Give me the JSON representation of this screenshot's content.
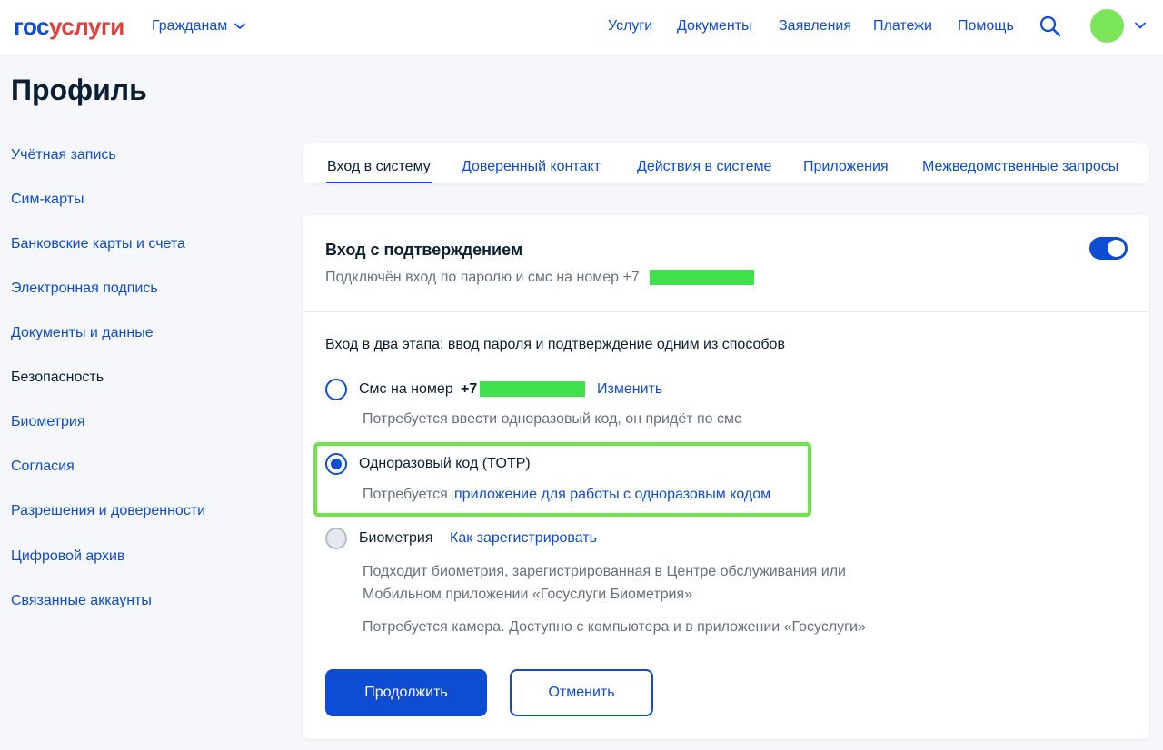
{
  "header": {
    "logo_part1": "гос",
    "logo_part2": "услуги",
    "audience": "Гражданам",
    "nav": [
      "Услуги",
      "Документы",
      "Заявления",
      "Платежи",
      "Помощь"
    ]
  },
  "page": {
    "title": "Профиль"
  },
  "sidebar": {
    "items": [
      {
        "label": "Учётная запись"
      },
      {
        "label": "Сим-карты"
      },
      {
        "label": "Банковские карты и счета"
      },
      {
        "label": "Электронная подпись"
      },
      {
        "label": "Документы и данные"
      },
      {
        "label": "Безопасность"
      },
      {
        "label": "Биометрия"
      },
      {
        "label": "Согласия"
      },
      {
        "label": "Разрешения и доверенности"
      },
      {
        "label": "Цифровой архив"
      },
      {
        "label": "Связанные аккаунты"
      }
    ],
    "active_index": 5
  },
  "tabs": [
    {
      "label": "Вход в систему"
    },
    {
      "label": "Доверенный контакт"
    },
    {
      "label": "Действия в системе"
    },
    {
      "label": "Приложения"
    },
    {
      "label": "Межведомственные запросы"
    }
  ],
  "confirm": {
    "title": "Вход с подтверждением",
    "description": "Подключён вход по паролю и смс на номер +7",
    "enabled": true
  },
  "methods": {
    "intro": "Вход в два этапа: ввод пароля и подтверждение одним из способов",
    "sms": {
      "label": "Смс на номер",
      "prefix": "+7",
      "change_link": "Изменить",
      "hint": "Потребуется ввести одноразовый код, он придёт по смс",
      "checked": false
    },
    "totp": {
      "label": "Одноразовый код (TOTP)",
      "hint_prefix": "Потребуется",
      "hint_link": "приложение для работы с одноразовым кодом",
      "checked": true
    },
    "biometry": {
      "label": "Биометрия",
      "register_link": "Как зарегистрировать",
      "hint_line1": "Подходит биометрия, зарегистрированная в Центре обслуживания или",
      "hint_line2": "Мобильном приложении «Госуслуги Биометрия»",
      "hint_line3": "Потребуется камера. Доступно с компьютера и в приложении «Госуслуги»",
      "disabled": true
    }
  },
  "buttons": {
    "continue": "Продолжить",
    "cancel": "Отменить"
  },
  "colors": {
    "brand_blue": "#0d4cd3",
    "brand_red": "#e3403b",
    "highlight_green": "#6ee54a"
  }
}
